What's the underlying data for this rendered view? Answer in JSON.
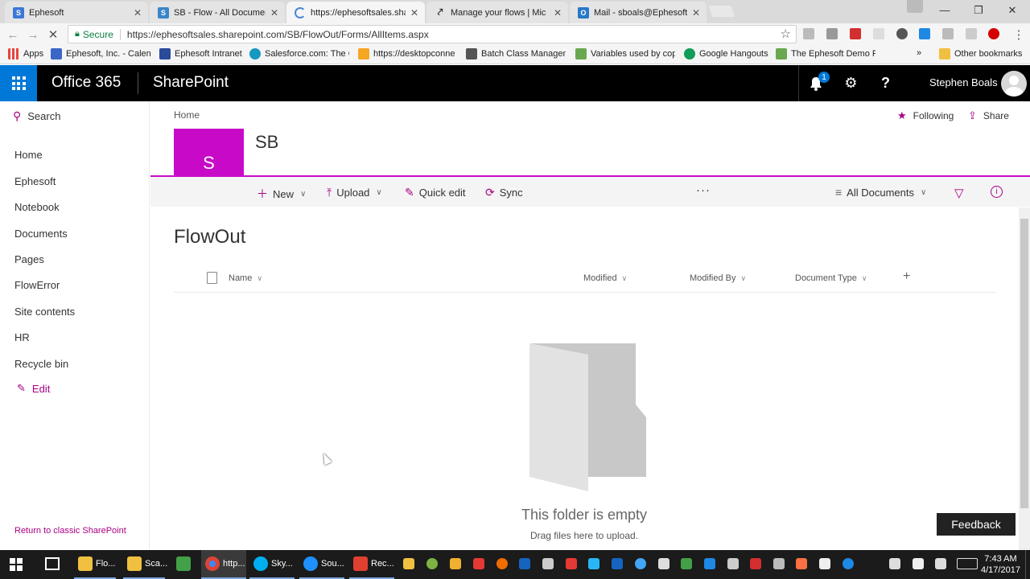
{
  "browser": {
    "tabs": [
      {
        "title": "Ephesoft",
        "color": "#3c78d8",
        "glyph": "S"
      },
      {
        "title": "SB - Flow - All Document",
        "color": "#3a86c8",
        "glyph": "S"
      },
      {
        "title": "https://ephesoftsales.sha",
        "color": "#ffffff",
        "glyph": ""
      },
      {
        "title": "Manage your flows | Mic",
        "color": "#444444",
        "glyph": ""
      },
      {
        "title": "Mail - sboals@EphesoftS",
        "color": "#2878c8",
        "glyph": "O"
      }
    ],
    "secure_label": "Secure",
    "url": "https://ephesoftsales.sharepoint.com/SB/FlowOut/Forms/AllItems.aspx",
    "bookmarks": [
      {
        "label": "Apps",
        "color": "#e8453c"
      },
      {
        "label": "Ephesoft, Inc. - Calenc",
        "color": "#3a66c8"
      },
      {
        "label": "Ephesoft Intranet",
        "color": "#2a4a9a"
      },
      {
        "label": "Salesforce.com: The C",
        "color": "#1798c1"
      },
      {
        "label": "https://desktopconne",
        "color": "#f5a623"
      },
      {
        "label": "Batch Class Managem",
        "color": "#555555"
      },
      {
        "label": "Variables used by cop",
        "color": "#6aa84f"
      },
      {
        "label": "Google Hangouts",
        "color": "#0f9d58"
      },
      {
        "label": "The Ephesoft Demo P",
        "color": "#6aa84f"
      }
    ],
    "more_bookmarks": "»",
    "other_bookmarks": "Other bookmarks"
  },
  "suitebar": {
    "brand": "Office 365",
    "app": "SharePoint",
    "notification_count": "1",
    "help_label": "?",
    "user_name": "Stephen Boals"
  },
  "leftnav": {
    "search_label": "Search",
    "items": [
      "Home",
      "Ephesoft",
      "Notebook",
      "Documents",
      "Pages",
      "FlowError",
      "Site contents",
      "HR",
      "Recycle bin"
    ],
    "edit_label": "Edit",
    "classic_label": "Return to classic SharePoint"
  },
  "header": {
    "breadcrumb": "Home",
    "following_label": "Following",
    "share_label": "Share",
    "site_initial": "S",
    "site_title": "SB",
    "accent_color": "#c80ac8"
  },
  "commands": {
    "new_label": "New",
    "upload_label": "Upload",
    "quick_edit_label": "Quick edit",
    "sync_label": "Sync",
    "more_label": "···",
    "view_label": "All Documents"
  },
  "library": {
    "title": "FlowOut",
    "columns": [
      "Name",
      "Modified",
      "Modified By",
      "Document Type"
    ],
    "empty_title": "This folder is empty",
    "empty_subtitle": "Drag files here to upload."
  },
  "feedback_label": "Feedback",
  "taskbar": {
    "apps": [
      {
        "label": "Flo...",
        "color": "#f0c040"
      },
      {
        "label": "Sca...",
        "color": "#f0c040"
      },
      {
        "label": "http...",
        "color": "#db4437"
      },
      {
        "label": "Sky...",
        "color": "#00aff0"
      },
      {
        "label": "Sou...",
        "color": "#1e90ff"
      },
      {
        "label": "Rec...",
        "color": "#e04030"
      }
    ],
    "time": "7:43 AM",
    "date": "4/17/2017"
  }
}
